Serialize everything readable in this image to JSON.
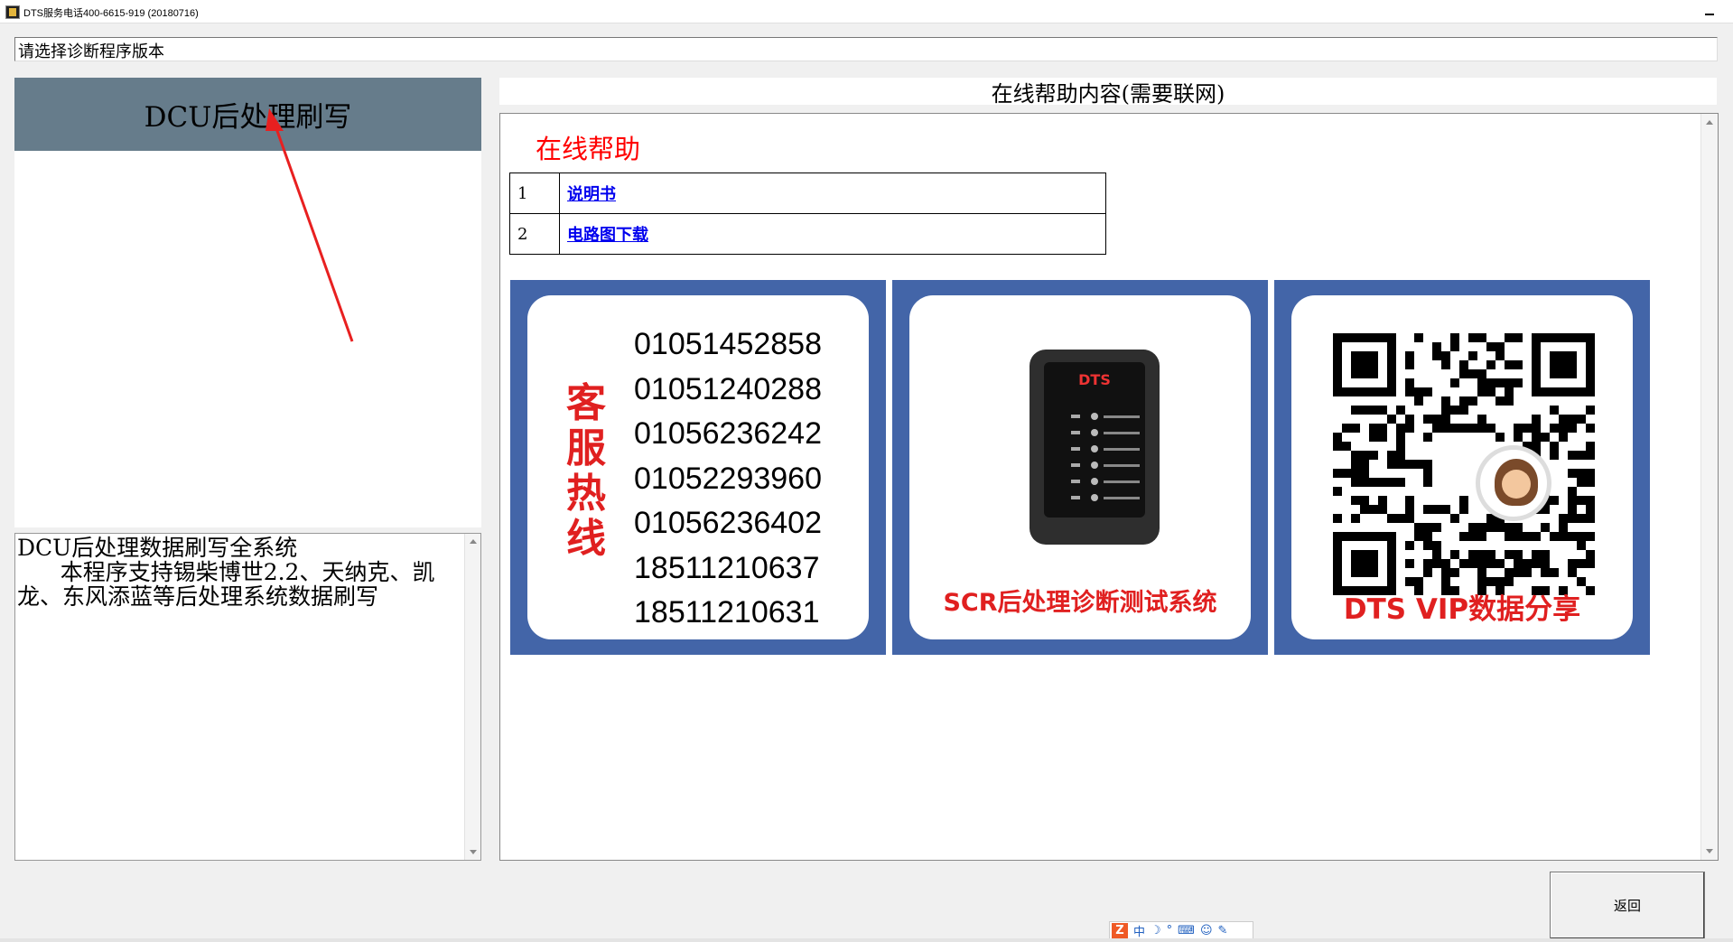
{
  "window": {
    "title": "DTS服务电话400-6615-919 (20180716)"
  },
  "prompt": "请选择诊断程序版本",
  "program_list": {
    "items": [
      "DCU后处理刷写"
    ],
    "selected_index": 0,
    "selected_color": "#667c8b"
  },
  "description": "DCU后处理数据刷写全系统\n      本程序支持锡柴博世2.2、天纳克、凯龙、东风添蓝等后处理系统数据刷写",
  "help": {
    "header": "在线帮助内容(需要联网)",
    "title": "在线帮助",
    "links": [
      {
        "num": "1",
        "label": "说明书"
      },
      {
        "num": "2",
        "label": "电路图下载"
      }
    ]
  },
  "banners": {
    "hotline": {
      "label": "客服热线",
      "phones": [
        "01051452858",
        "01051240288",
        "01056236242",
        "01052293960",
        "01056236402",
        "18511210637",
        "18511210631"
      ]
    },
    "device": {
      "brand": "DTS",
      "caption": "SCR后处理诊断测试系统"
    },
    "qr": {
      "caption": "DTS  VIP数据分享"
    },
    "banner_color": "#4365a8",
    "accent_red": "#e02020"
  },
  "buttons": {
    "back": "返回"
  },
  "ime": {
    "logo": "Z",
    "mode": "中"
  }
}
